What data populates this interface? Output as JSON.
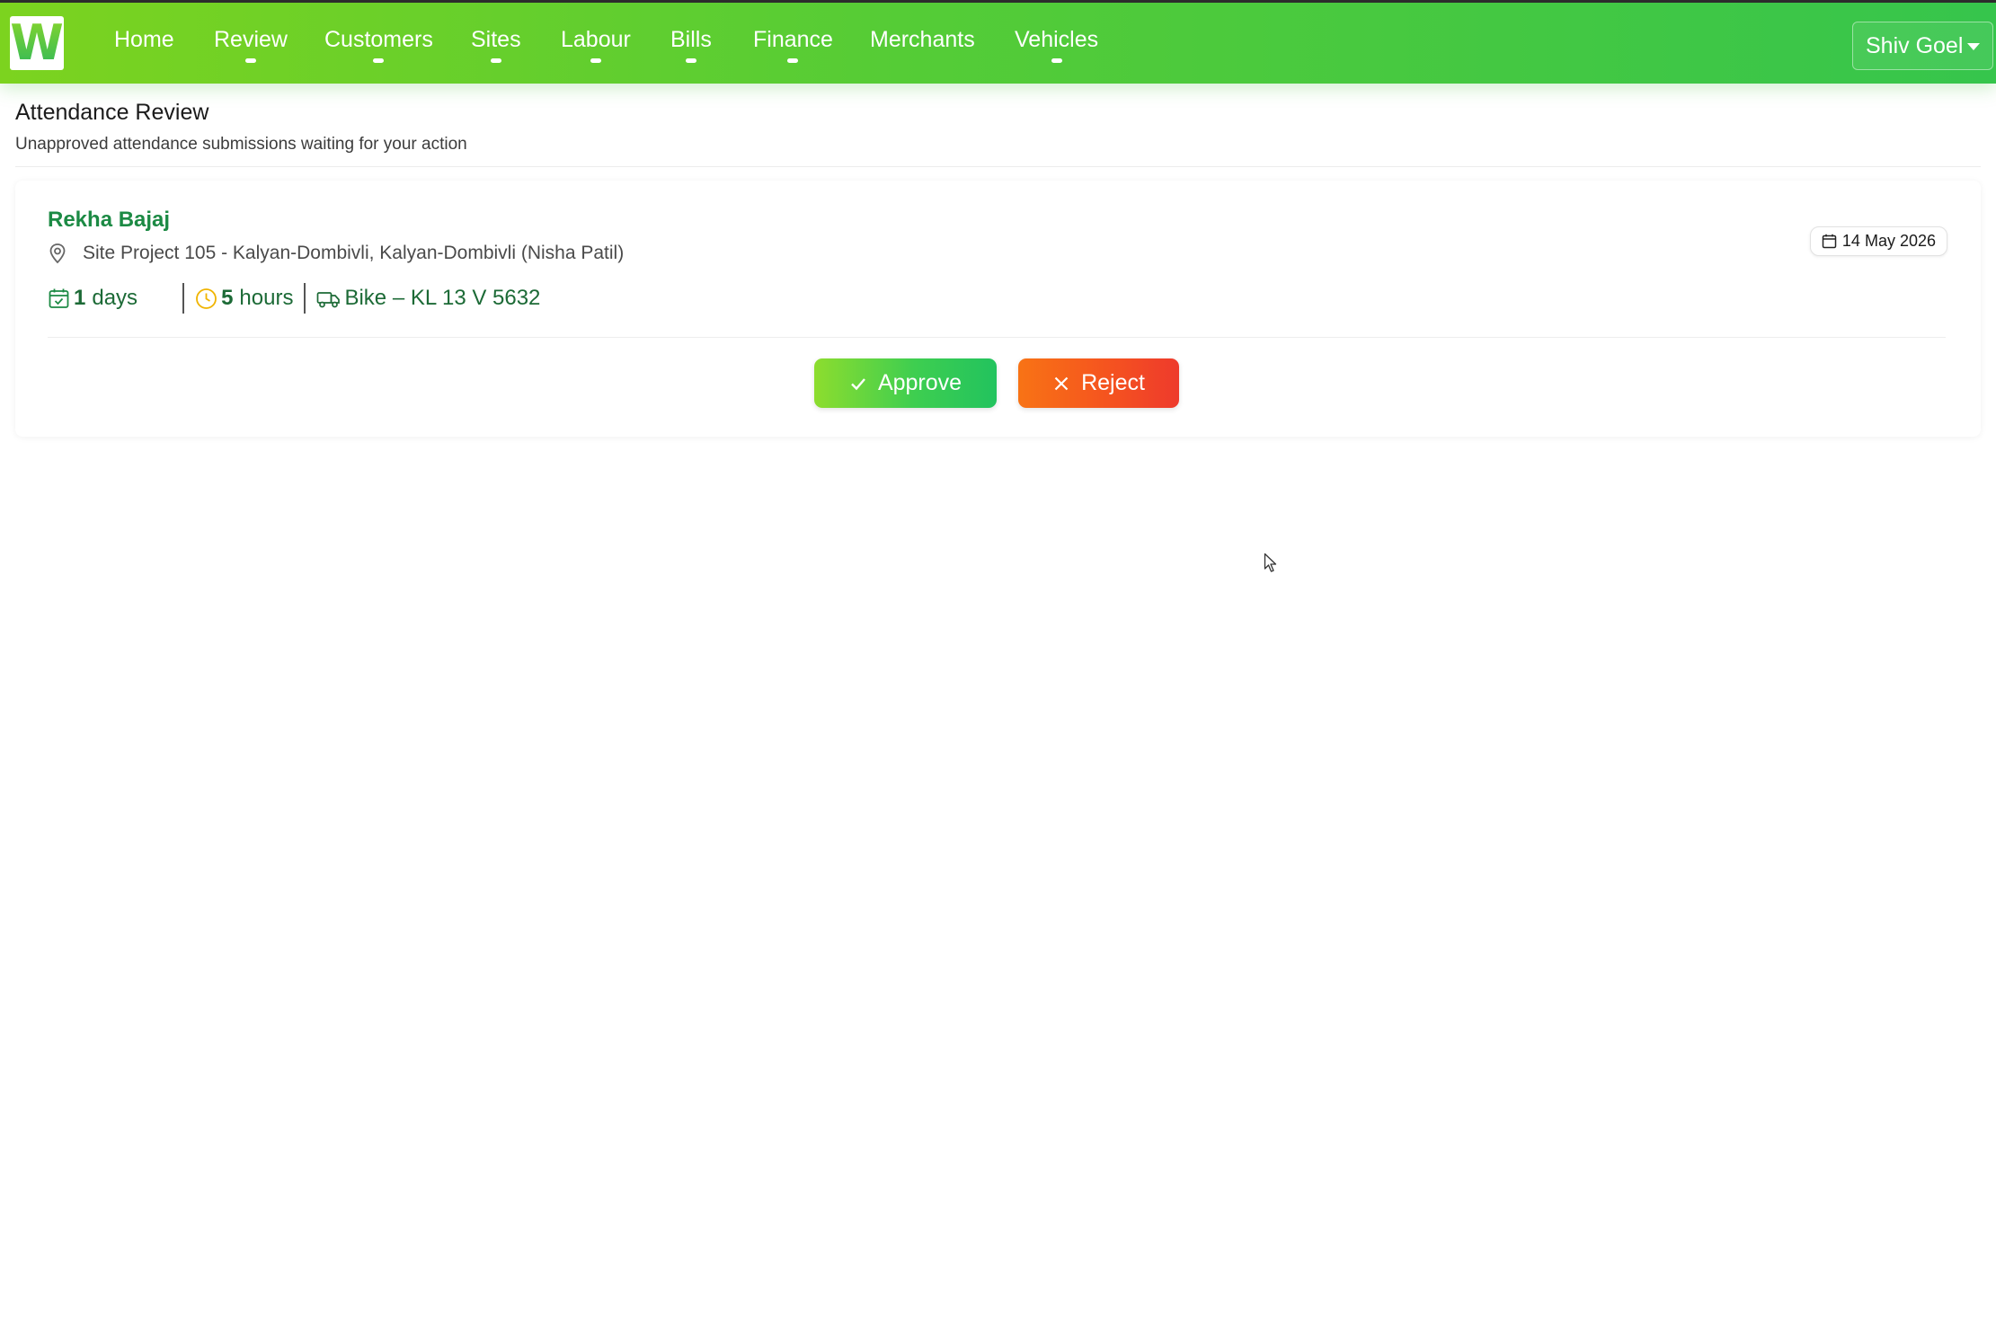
{
  "navbar": {
    "brand_letter": "W",
    "items": [
      {
        "label": "Home",
        "has_dropdown": false
      },
      {
        "label": "Review",
        "has_dropdown": true
      },
      {
        "label": "Customers",
        "has_dropdown": true
      },
      {
        "label": "Sites",
        "has_dropdown": true
      },
      {
        "label": "Labour",
        "has_dropdown": true
      },
      {
        "label": "Bills",
        "has_dropdown": true
      },
      {
        "label": "Finance",
        "has_dropdown": true
      },
      {
        "label": "Merchants",
        "has_dropdown": false
      },
      {
        "label": "Vehicles",
        "has_dropdown": true
      }
    ],
    "user_name": "Shiv Goel"
  },
  "page": {
    "title": "Attendance Review",
    "subtitle": "Unapproved attendance submissions waiting for your action"
  },
  "submission": {
    "name": "Rekha Bajaj",
    "location": "Site Project 105 - Kalyan-Dombivli, Kalyan-Dombivli (Nisha Patil)",
    "days_value": "1",
    "days_unit": "days",
    "hours_value": "5",
    "hours_unit": "hours",
    "vehicle": "Bike – KL 13 V 5632",
    "date": "14 May 2026",
    "approve_label": "Approve",
    "reject_label": "Reject"
  },
  "icons": {
    "location": "map-pin-icon",
    "days": "calendar-check-icon",
    "hours": "clock-icon",
    "vehicle": "truck-icon",
    "date": "calendar-icon",
    "approve": "check-icon",
    "reject": "x-icon",
    "user_menu": "caret-down-icon"
  },
  "colors": {
    "nav_gradient_start": "#7cd31f",
    "nav_gradient_end": "#36c54c",
    "name_green": "#1c8a44",
    "stat_green": "#1c6a36",
    "clock_amber": "#f0b400",
    "approve_start": "#8ddd2e",
    "approve_end": "#22c35e",
    "reject_start": "#f87315",
    "reject_end": "#ee3a2c"
  }
}
